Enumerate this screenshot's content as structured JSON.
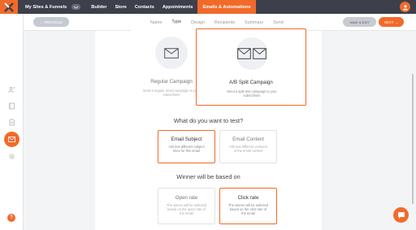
{
  "topbar": {
    "nav": [
      "My Sites & Funnels",
      "Builder",
      "Store",
      "Contacts",
      "Appointments",
      "Emails & Automations"
    ],
    "active_index": 5
  },
  "subbar": {
    "prev_label": "← PREVIOUS",
    "tabs": [
      "Name",
      "Type",
      "Design",
      "Recipients",
      "Summary",
      "Send"
    ],
    "active_tab": "Type",
    "save_label": "SAVE & EXIT",
    "next_label": "NEXT →"
  },
  "campaign": {
    "regular": {
      "title": "Regular Campaign",
      "desc": "Send a regular email campaign to your subscribers"
    },
    "ab": {
      "title": "A/B Split Campaign",
      "desc": "Send a split test campaign to your subscribers"
    }
  },
  "test_section": {
    "heading": "What do you want to test?",
    "subject": {
      "title": "Email Subject",
      "desc": "A/B test different subject lines for this email"
    },
    "content": {
      "title": "Email Content",
      "desc": "A/B test different versions of the email content"
    }
  },
  "winner_section": {
    "heading": "Winner will be based on",
    "open": {
      "title": "Open rate",
      "desc": "The winner will be selected based on the open rate of the email"
    },
    "click": {
      "title": "Click rate",
      "desc": "The winner will be selected based on the click rate of the email"
    }
  },
  "sidebar": {
    "bottom_badge": "?"
  },
  "colors": {
    "accent": "#f26a2a",
    "topbar": "#3d3f4a"
  }
}
